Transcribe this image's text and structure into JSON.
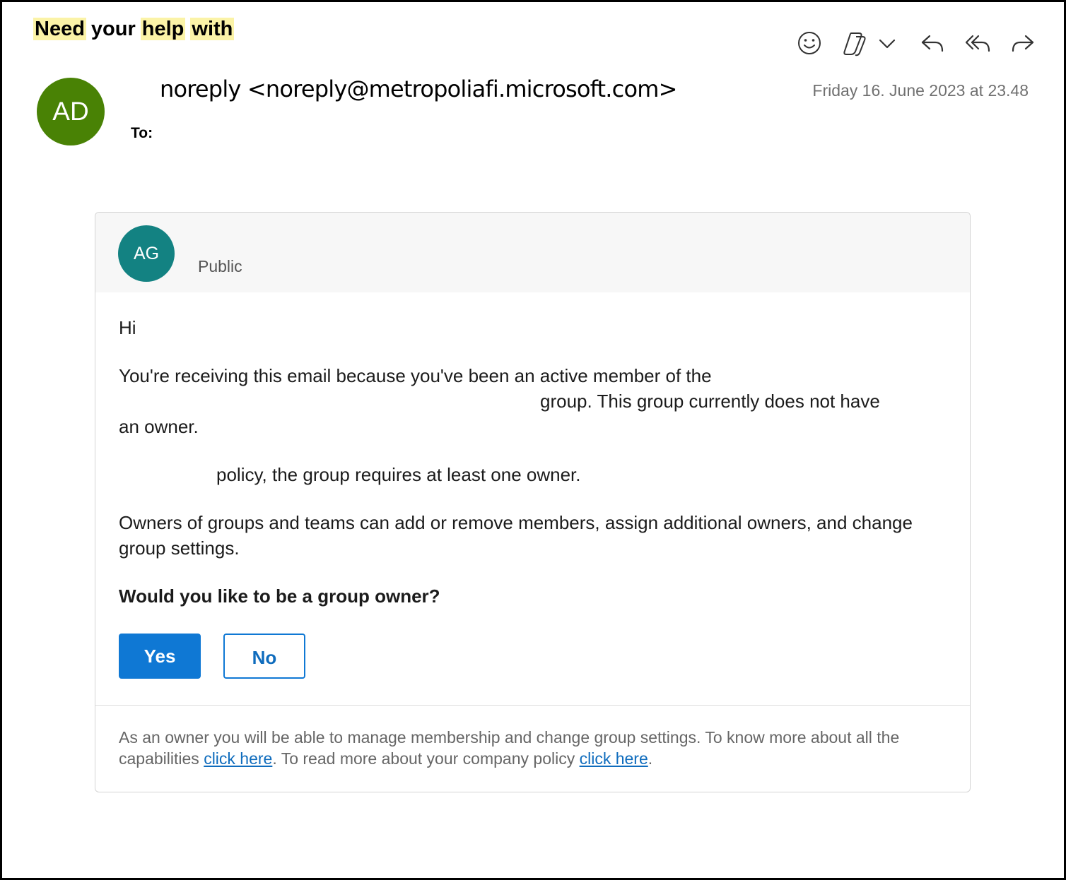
{
  "subject": {
    "words": [
      "Need",
      "your",
      "help",
      "with"
    ],
    "highlighted": [
      true,
      false,
      true,
      true
    ]
  },
  "toolbar": {
    "icons": [
      "smiley-icon",
      "copilot-icon",
      "chevron-down-icon",
      "reply-icon",
      "reply-all-icon",
      "forward-icon"
    ]
  },
  "sender": {
    "initials": "AD",
    "avatar_color": "#498205",
    "from": "noreply <noreply@metropoliafi.microsoft.com>",
    "date": "Friday 16. June 2023 at 23.48",
    "to_label": "To:"
  },
  "card": {
    "group_initials": "AG",
    "group_avatar_color": "#138282",
    "privacy": "Public",
    "greeting": "Hi",
    "para1_line1": "You're receiving this email because you've been an active member of the",
    "para1_line2": "group. This group currently does not have",
    "para1_line3": "an owner.",
    "para2": "policy, the group requires at least one owner.",
    "para3": "Owners of groups and teams can add or remove members, assign additional owners, and change group settings.",
    "question": "Would you like to be a group owner?",
    "yes_label": "Yes",
    "no_label": "No",
    "accent_color": "#0f78d4",
    "footer_text_1": "As an owner you will be able to manage membership and change group settings. To know more about all the capabilities",
    "footer_link_1": "click here",
    "footer_text_2": ". To read more about your company policy",
    "footer_link_2": "click here",
    "footer_text_3": "."
  }
}
